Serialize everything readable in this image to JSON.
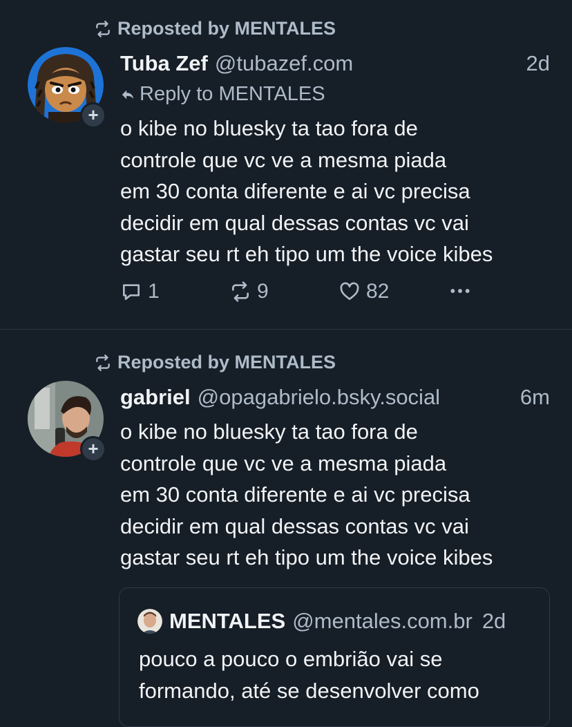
{
  "feed": {
    "posts": [
      {
        "repost_label": "Reposted by MENTALES",
        "author_name": "Tuba Zef",
        "author_handle": "@tubazef.com",
        "time": "2d",
        "reply_label": "Reply to MENTALES",
        "text_lines": [
          "o kibe no bluesky ta tao fora de",
          "controle que vc ve a mesma piada",
          "em 30 conta diferente e ai vc precisa",
          "decidir em qual dessas contas vc vai",
          "gastar seu rt eh tipo um the voice kibes"
        ],
        "replies": "1",
        "reposts": "9",
        "likes": "82",
        "follow_label": "+"
      },
      {
        "repost_label": "Reposted by MENTALES",
        "author_name": "gabriel",
        "author_handle": "@opagabrielo.bsky.social",
        "time": "6m",
        "text_lines": [
          "o kibe no bluesky ta tao fora de",
          "controle que vc ve a mesma piada",
          "em 30 conta diferente e ai vc precisa",
          "decidir em qual dessas contas vc vai",
          "gastar seu rt eh tipo um the voice kibes"
        ],
        "follow_label": "+",
        "quote": {
          "author_name": "MENTALES",
          "author_handle": "@mentales.com.br",
          "time": "2d",
          "text_lines": [
            "pouco a pouco o embrião vai se",
            "formando, até se desenvolver como"
          ]
        }
      }
    ]
  },
  "icons": {
    "repost": "repost-icon",
    "reply": "reply-arrow-icon",
    "comment": "comment-icon",
    "like": "heart-icon",
    "more": "more-dots-icon"
  },
  "colors": {
    "background": "#161e27",
    "text": "#f1f3f5",
    "muted": "#aebbc9",
    "divider": "#2b3540"
  }
}
